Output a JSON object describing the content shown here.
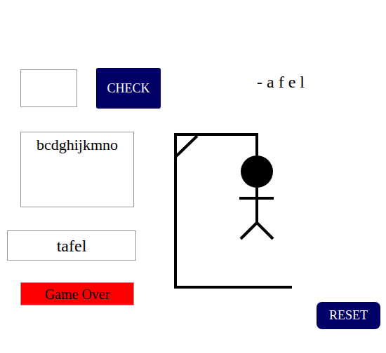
{
  "guess_input": {
    "value": ""
  },
  "check_button": {
    "label": "CHECK"
  },
  "word_display": "- a f e l",
  "wrong_letters": "bcdghijkmno",
  "answer": "tafel",
  "status": "Game Over",
  "hangman": {
    "head": true,
    "body": true,
    "arms": true,
    "legs": true
  },
  "reset_button": {
    "label": "RESET"
  }
}
